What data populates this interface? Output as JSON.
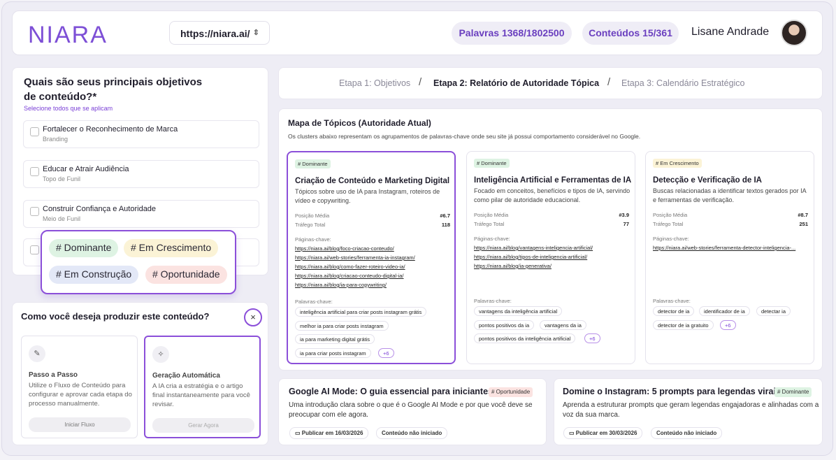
{
  "header": {
    "logo": "NIARA",
    "url": "https://niara.ai/",
    "words_pill": "Palavras 1368/1802500",
    "contents_pill": "Conteúdos 15/361",
    "user_name": "Lisane Andrade"
  },
  "goals": {
    "title": "Quais são seus principais objetivos de conteúdo?*",
    "subtitle": "Selecione todos que se aplicam",
    "options": [
      {
        "title": "Fortalecer o Reconhecimento de Marca",
        "sub": "Branding"
      },
      {
        "title": "Educar e Atrair Audiência",
        "sub": "Topo de Funil"
      },
      {
        "title": "Construir Confiança e Autoridade",
        "sub": "Meio de Funil"
      },
      {
        "title": "",
        "sub": ""
      }
    ]
  },
  "tags_popover": {
    "tags": [
      "# Dominante",
      "# Em Crescimento",
      "# Em Construção",
      "# Oportunidade"
    ],
    "colors": [
      "#def3e3",
      "#fbf3d6",
      "#e3e8f7",
      "#fbe3e1"
    ]
  },
  "production": {
    "title": "Como você deseja produzir este conteúdo?",
    "close_icon": "×",
    "modes": [
      {
        "title": "Passo a Passo",
        "desc": "Utilize o Fluxo de Conteúdo para configurar e aprovar cada etapa do processo manualmente.",
        "button": "Iniciar Fluxo",
        "icon": "✎"
      },
      {
        "title": "Geração Automática",
        "desc": "A IA cria a estratégia e o artigo final instantaneamente para você revisar.",
        "button": "Gerar Agora",
        "icon": "✧"
      }
    ]
  },
  "steps": {
    "s1": "Etapa 1:  Objetivos",
    "s2": "Etapa 2:  Relatório de Autoridade Tópica",
    "s3": "Etapa 3:  Calendário Estratégico",
    "sep": "/"
  },
  "map": {
    "title": "Mapa de Tópicos (Autoridade Atual)",
    "desc": "Os clusters abaixo representam os agrupamentos de palavras-chave onde seu site já possui comportamento considerável no Google.",
    "pos_label": "Posição Média",
    "traffic_label": "Tráfego Total",
    "pages_label": "Páginas-chave:",
    "kw_label": "Palavras-chave:",
    "clusters": [
      {
        "badge": "# Dominante",
        "title": "Criação de Conteúdo e Marketing Digital",
        "desc": "Tópicos sobre uso de IA para Instagram, roteiros de vídeo e copywriting.",
        "pos": "#6.7",
        "traffic": "118",
        "links": [
          "https://niara.ai/blog/foco-criacao-conteudo/",
          "https://niara.ai/web-stories/ferramenta-ia-instagram/",
          "https://niara.ai/blog/como-fazer-roteiro-video-ia/",
          "https://niara.ai/blog/criacao-conteudo-digital-ia/",
          "https://niara.ai/blog/ia-para-copywriting/"
        ],
        "keywords": [
          "inteligência artificial para criar posts instagram grátis",
          "melhor ia para criar posts instagram",
          "ia para marketing digital grátis",
          "ia para criar posts instagram"
        ],
        "more": "+6"
      },
      {
        "badge": "# Dominante",
        "title": "Inteligência Artificial e Ferramentas de IA",
        "desc": "Focado em conceitos, benefícios e tipos de IA, servindo como pilar de autoridade educacional.",
        "pos": "#3.9",
        "traffic": "77",
        "links": [
          "https://niara.ai/blog/vantagens-inteligencia-artificial/",
          "https://niara.ai/blog/tipos-de-inteligencia-artificial/",
          "https://niara.ai/blog/ia-generativa/"
        ],
        "keywords": [
          "vantagens da inteligência artificial",
          "pontos positivos da ia",
          "vantagens da ia",
          "pontos positivos da inteligência artificial"
        ],
        "more": "+6"
      },
      {
        "badge": "# Em Crescimento",
        "title": "Detecção e Verificação de IA",
        "desc": "Buscas relacionadas a identificar textos gerados por IA e ferramentas de verificação.",
        "pos": "#8.7",
        "traffic": "251",
        "links": [
          "https://niara.ai/web-stories/ferramenta-detector-inteligencia-..."
        ],
        "keywords": [
          "detector de ia",
          "identificador de ia",
          "detectar ia",
          "detector de ia gratuito"
        ],
        "more": "+6"
      }
    ]
  },
  "articles": [
    {
      "title": "Google AI Mode: O guia essencial para iniciantes",
      "badge": "# Oportunidade",
      "desc": "Uma introdução clara sobre o que é o Google AI Mode e por que você deve se preocupar com ele agora.",
      "date": "Publicar em 16/03/2026",
      "status": "Conteúdo não iniciado"
    },
    {
      "title": "Domine o Instagram: 5 prompts para legendas virais",
      "badge": "# Dominante",
      "desc": "Aprenda a estruturar prompts que geram legendas engajadoras e alinhadas com a voz da sua marca.",
      "date": "Publicar em 30/03/2026",
      "status": "Conteúdo não iniciado"
    }
  ],
  "colors": {
    "accent": "#8b4fd9",
    "dominante": "#def3e3",
    "crescimento": "#fbf3d6",
    "oportunidade": "#fbe3e1"
  }
}
